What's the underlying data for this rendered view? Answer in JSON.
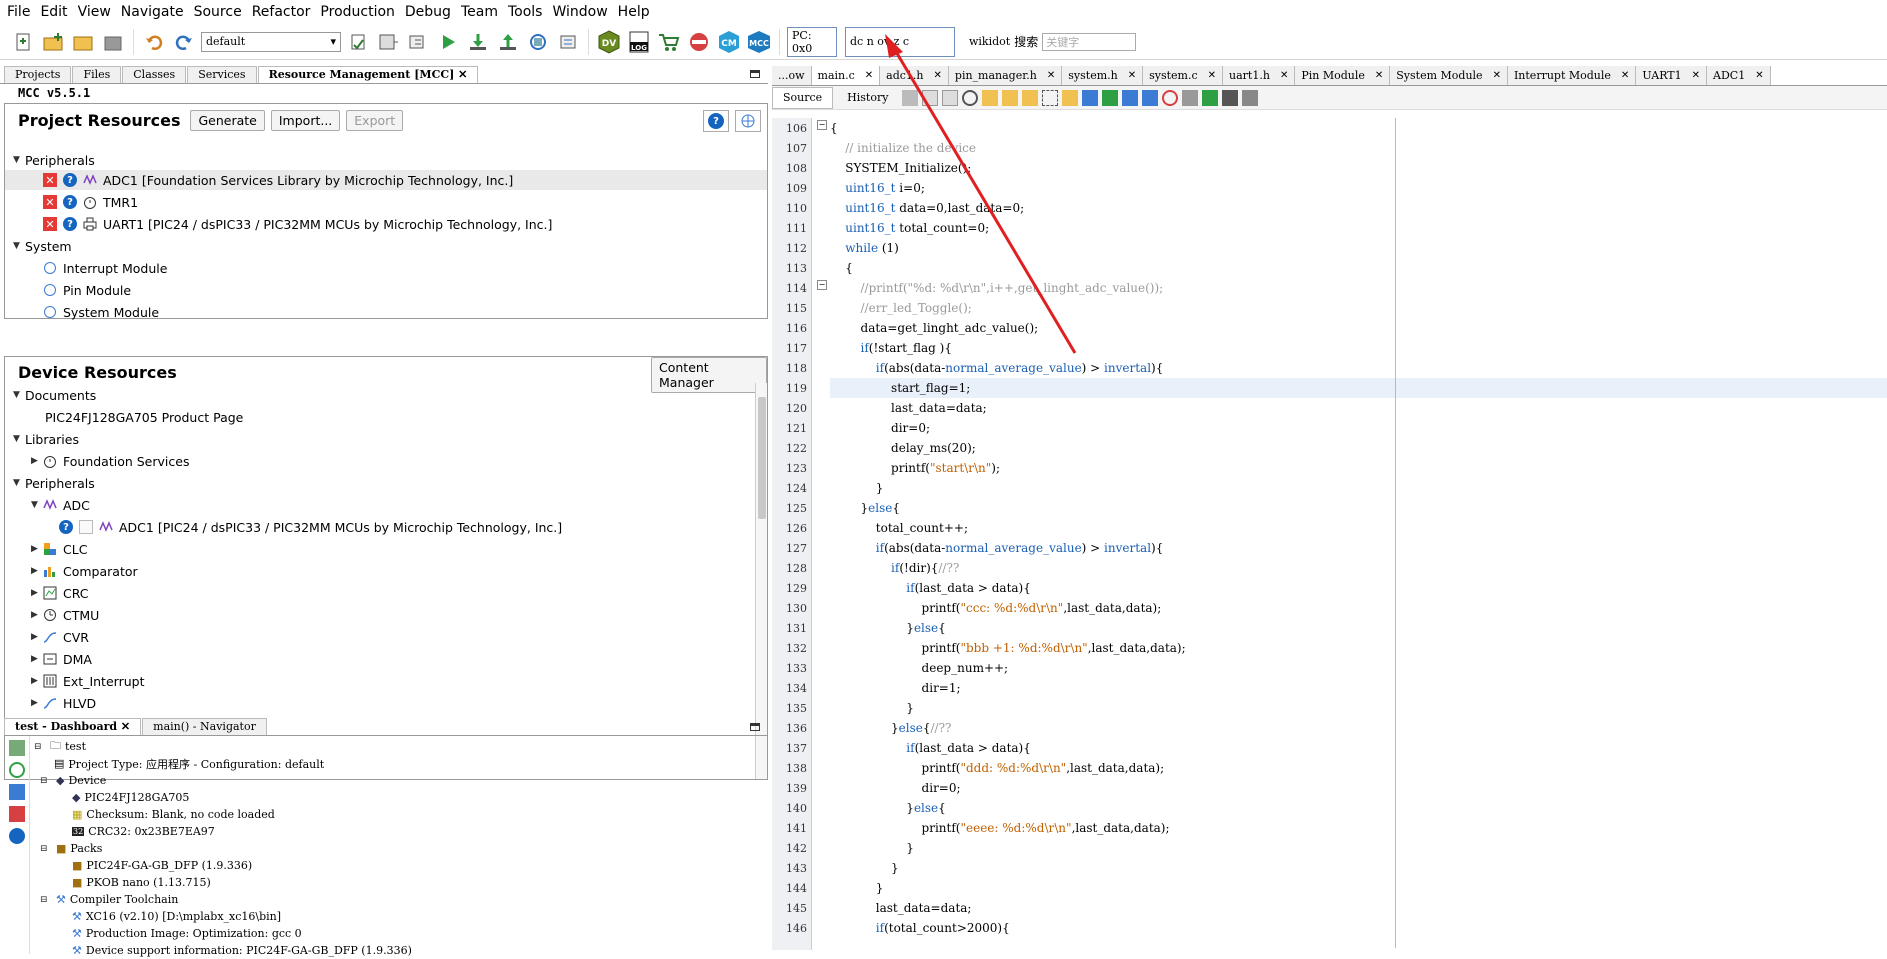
{
  "menu": [
    "File",
    "Edit",
    "View",
    "Navigate",
    "Source",
    "Refactor",
    "Production",
    "Debug",
    "Team",
    "Tools",
    "Window",
    "Help"
  ],
  "toolbar": {
    "config": "default",
    "pc": "PC: 0x0",
    "status_bits": "dc n ov z c",
    "wikidot": "wikidot",
    "search_label": "搜索",
    "search_placeholder": "关键字",
    "dv_label": "DV",
    "log_label": "LOG",
    "cm_label": "CM",
    "mcc_label": "MCC"
  },
  "left_tabs": [
    "Projects",
    "Files",
    "Classes",
    "Services",
    "Resource Management [MCC]"
  ],
  "mcc_version": "MCC v5.5.1",
  "project_resources": {
    "title": "Project Resources",
    "generate": "Generate",
    "import": "Import...",
    "export": "Export",
    "peripherals_label": "Peripherals",
    "peripherals": [
      "ADC1 [Foundation Services Library by Microchip Technology, Inc.]",
      "TMR1",
      "UART1 [PIC24 / dsPIC33 / PIC32MM MCUs by Microchip Technology, Inc.]"
    ],
    "system_label": "System",
    "system": [
      "Interrupt Module",
      "Pin Module",
      "System Module"
    ]
  },
  "device_resources": {
    "title": "Device Resources",
    "content_manager": "Content Manager",
    "documents_label": "Documents",
    "product_page": "PIC24FJ128GA705 Product Page",
    "libraries_label": "Libraries",
    "foundation": "Foundation Services",
    "peripherals_label": "Peripherals",
    "adc_label": "ADC",
    "adc_item": "ADC1 [PIC24 / dsPIC33 / PIC32MM MCUs by Microchip Technology, Inc.]",
    "items": [
      "CLC",
      "Comparator",
      "CRC",
      "CTMU",
      "CVR",
      "DMA",
      "Ext_Interrupt",
      "HLVD"
    ]
  },
  "dashboard": {
    "tabs": [
      "test - Dashboard",
      "main() - Navigator"
    ],
    "rows": [
      "test",
      "Project Type: 应用程序 - Configuration: default",
      "Device",
      "PIC24FJ128GA705",
      "Checksum: Blank, no code loaded",
      "CRC32: 0x23BE7EA97",
      "Packs",
      "PIC24F-GA-GB_DFP (1.9.336)",
      "PKOB nano (1.13.715)",
      "Compiler Toolchain",
      "XC16 (v2.10) [D:\\mplabx_xc16\\bin]",
      "Production Image: Optimization: gcc 0",
      "Device support information: PIC24F-GA-GB_DFP (1.9.336)"
    ]
  },
  "editor": {
    "tabs": [
      "...ow",
      "main.c",
      "adc1.h",
      "pin_manager.h",
      "system.h",
      "system.c",
      "uart1.h",
      "Pin Module",
      "System Module",
      "Interrupt Module",
      "UART1",
      "ADC1"
    ],
    "source": "Source",
    "history": "History",
    "lines": [
      {
        "n": "106",
        "t": "{"
      },
      {
        "n": "107",
        "t": "    // initialize the device"
      },
      {
        "n": "108",
        "t": "    SYSTEM_Initialize();"
      },
      {
        "n": "109",
        "t": "    uint16_t i=0;"
      },
      {
        "n": "110",
        "t": "    uint16_t data=0,last_data=0;"
      },
      {
        "n": "111",
        "t": "    uint16_t total_count=0;"
      },
      {
        "n": "112",
        "t": "    while (1)"
      },
      {
        "n": "113",
        "t": "    {"
      },
      {
        "n": "114",
        "t": "        //printf(\"%d: %d\\r\\n\",i++,get_linght_adc_value());"
      },
      {
        "n": "115",
        "t": "        //err_led_Toggle();"
      },
      {
        "n": "116",
        "t": "        data=get_linght_adc_value();"
      },
      {
        "n": "117",
        "t": "        if(!start_flag ){"
      },
      {
        "n": "118",
        "t": "            if(abs(data-normal_average_value) > invertal){"
      },
      {
        "n": "119",
        "t": "                start_flag=1;"
      },
      {
        "n": "120",
        "t": "                last_data=data;"
      },
      {
        "n": "121",
        "t": "                dir=0;"
      },
      {
        "n": "122",
        "t": "                delay_ms(20);"
      },
      {
        "n": "123",
        "t": "                printf(\"start\\r\\n\");"
      },
      {
        "n": "124",
        "t": "            }"
      },
      {
        "n": "125",
        "t": "        }else{"
      },
      {
        "n": "126",
        "t": "            total_count++;"
      },
      {
        "n": "127",
        "t": "            if(abs(data-normal_average_value) > invertal){"
      },
      {
        "n": "128",
        "t": "                if(!dir){//??"
      },
      {
        "n": "129",
        "t": "                    if(last_data > data){"
      },
      {
        "n": "130",
        "t": "                        printf(\"ccc: %d:%d\\r\\n\",last_data,data);"
      },
      {
        "n": "131",
        "t": "                    }else{"
      },
      {
        "n": "132",
        "t": "                        printf(\"bbb +1: %d:%d\\r\\n\",last_data,data);"
      },
      {
        "n": "133",
        "t": "                        deep_num++;"
      },
      {
        "n": "134",
        "t": "                        dir=1;"
      },
      {
        "n": "135",
        "t": "                    }"
      },
      {
        "n": "136",
        "t": "                }else{//??"
      },
      {
        "n": "137",
        "t": "                    if(last_data > data){"
      },
      {
        "n": "138",
        "t": "                        printf(\"ddd: %d:%d\\r\\n\",last_data,data);"
      },
      {
        "n": "139",
        "t": "                        dir=0;"
      },
      {
        "n": "140",
        "t": "                    }else{"
      },
      {
        "n": "141",
        "t": "                        printf(\"eeee: %d:%d\\r\\n\",last_data,data);"
      },
      {
        "n": "142",
        "t": "                    }"
      },
      {
        "n": "143",
        "t": "                }"
      },
      {
        "n": "144",
        "t": "            }"
      },
      {
        "n": "145",
        "t": "            last_data=data;"
      },
      {
        "n": "146",
        "t": "            if(total_count>2000){"
      }
    ]
  },
  "colors": {
    "accent": "#1a5fb4",
    "arrow": "#e02020",
    "string": "#c06000",
    "comment": "#9a9a9a"
  }
}
